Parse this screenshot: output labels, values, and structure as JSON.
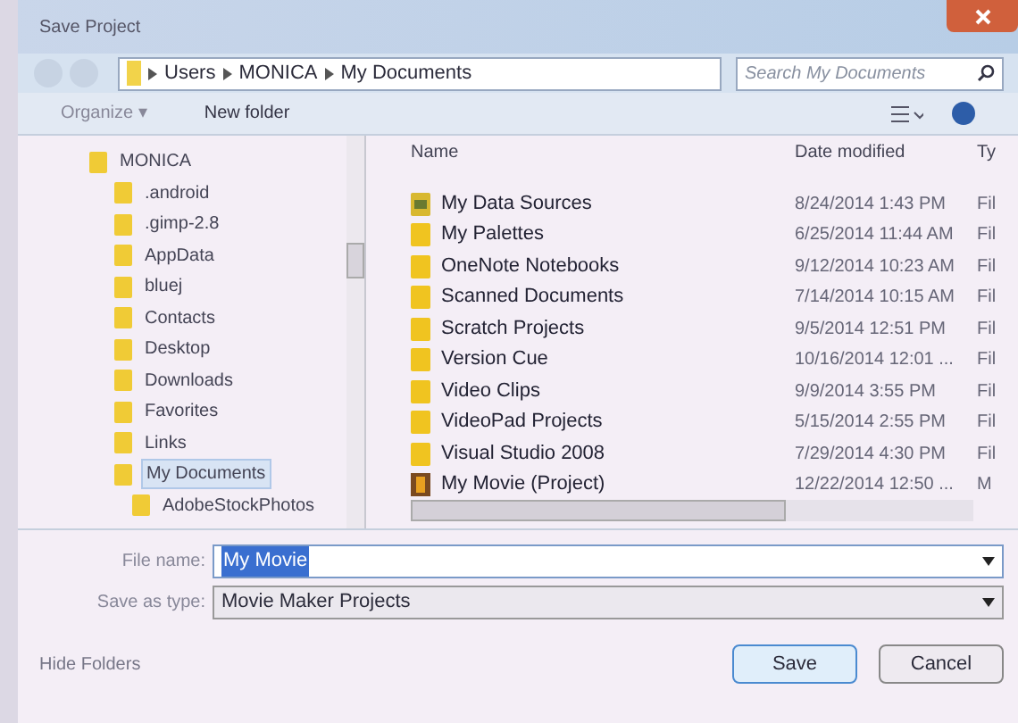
{
  "window": {
    "title": "Save Project"
  },
  "address_bar": {
    "path": [
      "Users",
      "MONICA",
      "My Documents"
    ],
    "search_placeholder": "Search My Documents"
  },
  "toolbar": {
    "organize": "Organize ▾",
    "new_folder": "New folder"
  },
  "tree": [
    {
      "label": "MONICA",
      "selected": false,
      "children": [
        {
          "label": ".android",
          "selected": false
        },
        {
          "label": ".gimp-2.8",
          "selected": false
        },
        {
          "label": "AppData",
          "selected": false
        },
        {
          "label": "bluej",
          "selected": false
        },
        {
          "label": "Contacts",
          "selected": false
        },
        {
          "label": "Desktop",
          "selected": false
        },
        {
          "label": "Downloads",
          "selected": false
        },
        {
          "label": "Favorites",
          "selected": false
        },
        {
          "label": "Links",
          "selected": false
        },
        {
          "label": "My Documents",
          "selected": true,
          "children": [
            {
              "label": "AdobeStockPhotos",
              "selected": false
            }
          ]
        }
      ]
    }
  ],
  "table": {
    "columns": [
      "Name",
      "Date modified",
      "Ty"
    ],
    "rows": [
      {
        "kind": "special",
        "name": "My Data Sources",
        "date": "8/24/2014 1:43 PM",
        "column_3": "Fil"
      },
      {
        "kind": "folder",
        "name": "My Palettes",
        "date": "6/25/2014 11:44 AM",
        "column_3": "Fil"
      },
      {
        "kind": "folder",
        "name": "OneNote Notebooks",
        "date": "9/12/2014 10:23 AM",
        "column_3": "Fil"
      },
      {
        "kind": "folder",
        "name": "Scanned Documents",
        "date": "7/14/2014 10:15 AM",
        "column_3": "Fil"
      },
      {
        "kind": "folder",
        "name": "Scratch Projects",
        "date": "9/5/2014 12:51 PM",
        "column_3": "Fil"
      },
      {
        "kind": "folder",
        "name": "Version Cue",
        "date": "10/16/2014 12:01 ...",
        "column_3": "Fil"
      },
      {
        "kind": "folder",
        "name": "Video Clips",
        "date": "9/9/2014 3:55 PM",
        "column_3": "Fil"
      },
      {
        "kind": "folder",
        "name": "VideoPad Projects",
        "date": "5/15/2014 2:55 PM",
        "column_3": "Fil"
      },
      {
        "kind": "folder",
        "name": "Visual Studio 2008",
        "date": "7/29/2014 4:30 PM",
        "column_3": "Fil"
      },
      {
        "kind": "project",
        "name": "My Movie (Project)",
        "date": "12/22/2014 12:50 ...",
        "column_3": "M"
      }
    ]
  },
  "form": {
    "file_name_label": "File name:",
    "file_name": "My Movie",
    "type_label": "Save as type:",
    "type": "Movie Maker Projects"
  },
  "footer": {
    "hide_folders": "Hide Folders",
    "buttons": [
      "Save",
      "Cancel"
    ]
  }
}
